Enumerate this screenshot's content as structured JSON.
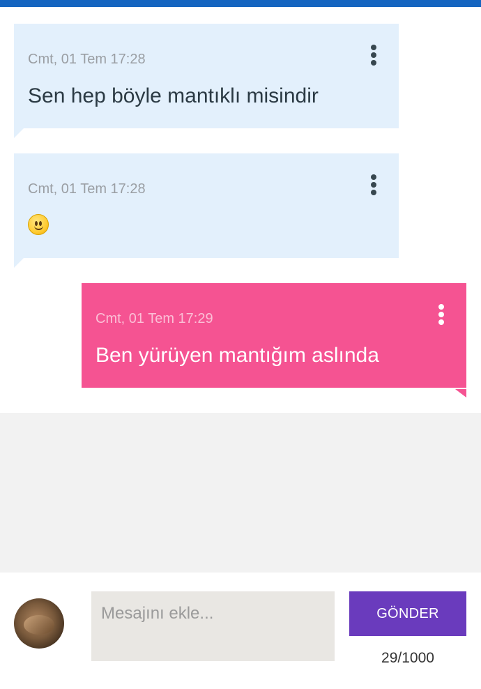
{
  "colors": {
    "top_bar": "#1565c0",
    "received_bubble": "#e3f0fc",
    "sent_bubble": "#f55392",
    "send_button": "#6a3bbd",
    "input_background": "#e9e7e3"
  },
  "messages": [
    {
      "direction": "received",
      "time": "Cmt, 01 Tem 17:28",
      "text": "Sen hep böyle mantıklı misindir",
      "menu_icon": "more-vert-icon"
    },
    {
      "direction": "received",
      "time": "Cmt, 01 Tem 17:28",
      "text": "",
      "emoji": "slightly-smiling-face",
      "menu_icon": "more-vert-icon"
    },
    {
      "direction": "sent",
      "time": "Cmt, 01 Tem 17:29",
      "text": "Ben yürüyen mantığım aslında",
      "menu_icon": "more-vert-icon"
    }
  ],
  "composer": {
    "avatar": "user-avatar-cat-photo",
    "placeholder": "Mesajını ekle...",
    "value": "",
    "send_label": "GÖNDER",
    "char_count": "29/1000"
  }
}
